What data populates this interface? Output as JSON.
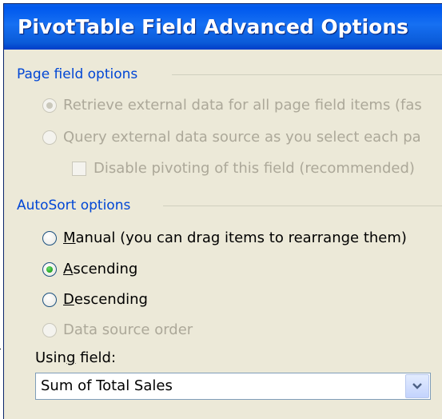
{
  "window": {
    "title": "PivotTable Field Advanced Options"
  },
  "page_field_options": {
    "label": "Page field options",
    "retrieve_all": {
      "label": "Retrieve external data for all page field items (fas",
      "selected": true,
      "enabled": false
    },
    "query_each": {
      "label": "Query external data source as you select each pa",
      "selected": false,
      "enabled": false
    },
    "disable_pivoting": {
      "label": "Disable pivoting of this field (recommended)",
      "checked": false,
      "enabled": false
    }
  },
  "autosort_options": {
    "label": "AutoSort options",
    "manual": {
      "mnemonic": "M",
      "label_rest": "anual (you can drag items to rearrange them)",
      "selected": false
    },
    "ascending": {
      "mnemonic": "A",
      "label_rest": "scending",
      "selected": true
    },
    "descending": {
      "mnemonic": "D",
      "label_rest": "escending",
      "selected": false
    },
    "data_source_order": {
      "label": "Data source order",
      "selected": false,
      "enabled": false
    }
  },
  "using_field": {
    "label_before": "Usin",
    "mnemonic": "g",
    "label_after": " field:",
    "value": "Sum of Total Sales"
  },
  "icons": {
    "dropdown": "chevron-down-icon"
  }
}
